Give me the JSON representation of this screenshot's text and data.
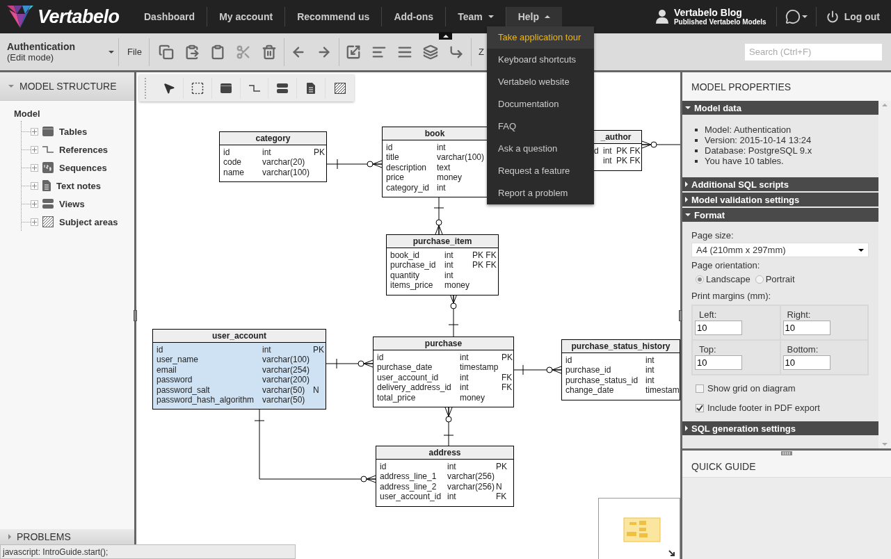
{
  "nav": {
    "logo": "Vertabelo",
    "items": [
      {
        "label": "Dashboard",
        "selected": false,
        "has_menu": false
      },
      {
        "label": "My account",
        "selected": false,
        "has_menu": false
      },
      {
        "label": "Recommend us",
        "selected": false,
        "has_menu": false
      },
      {
        "label": "Add-ons",
        "selected": false,
        "has_menu": false
      },
      {
        "label": "Team",
        "selected": false,
        "has_menu": true
      },
      {
        "label": "Help",
        "selected": true,
        "has_menu": true
      }
    ],
    "blog_title": "Vertabelo Blog",
    "blog_subtitle": "Published Vertabelo Models",
    "logout": "Log out"
  },
  "help_menu": [
    {
      "label": "Take application tour",
      "hovered": true
    },
    {
      "label": "Keyboard shortcuts",
      "hovered": false
    },
    {
      "label": "Vertabelo website",
      "hovered": false
    },
    {
      "label": "Documentation",
      "hovered": false
    },
    {
      "label": "FAQ",
      "hovered": false
    },
    {
      "label": "Ask a question",
      "hovered": false
    },
    {
      "label": "Request a feature",
      "hovered": false
    },
    {
      "label": "Report a problem",
      "hovered": false
    }
  ],
  "toolbar": {
    "model_name": "Authentication",
    "mode": "(Edit mode)",
    "file": "File",
    "zoom_label": "Z",
    "search_placeholder": "Search (Ctrl+F)"
  },
  "sidebar": {
    "title": "MODEL STRUCTURE",
    "root": "Model",
    "items": [
      {
        "label": "Tables",
        "kind": "table",
        "expanded": false
      },
      {
        "label": "References",
        "kind": "reference",
        "expanded": false
      },
      {
        "label": "Sequences",
        "kind": "sequence",
        "expanded": false
      },
      {
        "label": "Text notes",
        "kind": "note",
        "expanded": false
      },
      {
        "label": "Views",
        "kind": "view",
        "expanded": false
      },
      {
        "label": "Subject areas",
        "kind": "area",
        "expanded": false
      }
    ],
    "bottom_panel": "PROBLEMS"
  },
  "diagram": {
    "tables": [
      {
        "name": "category",
        "selected": false,
        "columns": [
          {
            "name": "id",
            "type": "int",
            "key": "PK"
          },
          {
            "name": "code",
            "type": "varchar(20)"
          },
          {
            "name": "name",
            "type": "varchar(100)"
          }
        ]
      },
      {
        "name": "book",
        "selected": false,
        "columns": [
          {
            "name": "id",
            "type": "int"
          },
          {
            "name": "title",
            "type": "varchar(100)"
          },
          {
            "name": "description",
            "type": "text"
          },
          {
            "name": "price",
            "type": "money"
          },
          {
            "name": "category_id",
            "type": "int"
          }
        ]
      },
      {
        "name": "_author",
        "selected": false,
        "columns": [
          {
            "name": "d",
            "type": "int",
            "key": "PK FK"
          },
          {
            "type": "int",
            "key": "PK FK"
          }
        ]
      },
      {
        "name": "purchase_item",
        "selected": false,
        "columns": [
          {
            "name": "book_id",
            "type": "int",
            "key": "PK FK"
          },
          {
            "name": "purchase_id",
            "type": "int",
            "key": "PK FK"
          },
          {
            "name": "quantity",
            "type": "int"
          },
          {
            "name": "items_price",
            "type": "money"
          }
        ]
      },
      {
        "name": "user_account",
        "selected": true,
        "columns": [
          {
            "name": "id",
            "type": "int",
            "key": "PK"
          },
          {
            "name": "user_name",
            "type": "varchar(100)"
          },
          {
            "name": "email",
            "type": "varchar(254)"
          },
          {
            "name": "password",
            "type": "varchar(200)"
          },
          {
            "name": "password_salt",
            "type": "varchar(50)",
            "key": "N"
          },
          {
            "name": "password_hash_algorithm",
            "type": "varchar(50)"
          }
        ]
      },
      {
        "name": "purchase",
        "selected": false,
        "columns": [
          {
            "name": "id",
            "type": "int",
            "key": "PK"
          },
          {
            "name": "purchase_date",
            "type": "timestamp"
          },
          {
            "name": "user_account_id",
            "type": "int",
            "key": "FK"
          },
          {
            "name": "delivery_address_id",
            "type": "int",
            "key": "FK"
          },
          {
            "name": "total_price",
            "type": "money"
          }
        ]
      },
      {
        "name": "purchase_status_history",
        "selected": false,
        "columns": [
          {
            "name": "id",
            "type": "int"
          },
          {
            "name": "purchase_id",
            "type": "int"
          },
          {
            "name": "purchase_status_id",
            "type": "int"
          },
          {
            "name": "change_date",
            "type": "timestam"
          }
        ]
      },
      {
        "name": "address",
        "selected": false,
        "columns": [
          {
            "name": "id",
            "type": "int",
            "key": "PK"
          },
          {
            "name": "address_line_1",
            "type": "varchar(256)"
          },
          {
            "name": "address_line_2",
            "type": "varchar(256)",
            "key": "N"
          },
          {
            "name": "user_account_id",
            "type": "int",
            "key": "FK"
          }
        ]
      }
    ]
  },
  "properties": {
    "title": "MODEL PROPERTIES",
    "sections": [
      {
        "title": "Model data",
        "expanded": true,
        "items": [
          "Model: Authentication",
          "Version: 2015-10-14 13:24",
          "Database: PostgreSQL 9.x",
          "You have 10 tables."
        ]
      },
      {
        "title": "Additional SQL scripts",
        "expanded": false
      },
      {
        "title": "Model validation settings",
        "expanded": false
      },
      {
        "title": "Format",
        "expanded": true,
        "form": {
          "page_size_label": "Page size:",
          "page_size": "A4 (210mm x 297mm)",
          "orientation_label": "Page orientation:",
          "orientation": [
            {
              "label": "Landscape",
              "selected": true
            },
            {
              "label": "Portrait",
              "selected": false
            }
          ],
          "margins_label": "Print margins (mm):",
          "margins": [
            {
              "label": "Left:",
              "value": "10"
            },
            {
              "label": "Right:",
              "value": "10"
            },
            {
              "label": "Top:",
              "value": "10"
            },
            {
              "label": "Bottom:",
              "value": "10"
            }
          ],
          "checkboxes": [
            {
              "label": "Show grid on diagram",
              "checked": false
            },
            {
              "label": "Include footer in PDF export",
              "checked": true
            }
          ]
        }
      },
      {
        "title": "SQL generation settings",
        "expanded": false
      }
    ]
  },
  "quick_guide": {
    "title": "QUICK GUIDE"
  },
  "header_toggle": {
    "expanded": true
  },
  "status_text": "javascript: IntroGuide.start();"
}
